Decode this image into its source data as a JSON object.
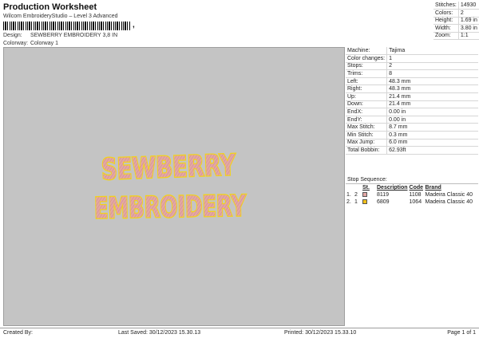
{
  "header": {
    "title": "Production Worksheet",
    "subtitle": "Wilcom EmbroideryStudio – Level 3 Advanced",
    "barcode_suffix": ","
  },
  "design": {
    "label": "Design:",
    "value": "SEWBERRY EMBROIDERY 3,8 IN"
  },
  "colorway": {
    "label": "Colorway:",
    "value": "Colorway 1"
  },
  "stats": [
    {
      "label": "Stitches:",
      "value": "14930"
    },
    {
      "label": "Colors:",
      "value": "2"
    },
    {
      "label": "Height:",
      "value": "1.69 in"
    },
    {
      "label": "Width:",
      "value": "3.80 in"
    },
    {
      "label": "Zoom:",
      "value": "1:1"
    }
  ],
  "canvas": {
    "line1": "SEWBERRY",
    "line2": "EMBROIDERY",
    "background": "#c4c4c4",
    "fill_color": "#e3a7a5",
    "outline_color": "#f2d21a"
  },
  "machine_info": [
    {
      "label": "Machine:",
      "value": "Tajima"
    },
    {
      "label": "Color changes:",
      "value": "1"
    },
    {
      "label": "Stops:",
      "value": "2"
    },
    {
      "label": "Trims:",
      "value": "8"
    },
    {
      "label": "Left:",
      "value": "48.3 mm"
    },
    {
      "label": "Right:",
      "value": "48.3 mm"
    },
    {
      "label": "Up:",
      "value": "21.4 mm"
    },
    {
      "label": "Down:",
      "value": "21.4 mm"
    },
    {
      "label": "EndX:",
      "value": "0.00 in"
    },
    {
      "label": "EndY:",
      "value": "0.00 in"
    },
    {
      "label": "Max Stitch:",
      "value": "8.7 mm"
    },
    {
      "label": "Min Stitch:",
      "value": "0.3 mm"
    },
    {
      "label": "Max Jump:",
      "value": "6.0 mm"
    },
    {
      "label": "Total Bobbin:",
      "value": "62.93ft"
    }
  ],
  "stop_sequence": {
    "title": "Stop Sequence:",
    "headers": {
      "st": "St.",
      "description": "Description",
      "code": "Code",
      "brand": "Brand"
    },
    "rows": [
      {
        "num": "1.",
        "st": "2",
        "swatch": "#e3a7a5",
        "description": "8119",
        "code": "1108",
        "brand": "Madeira Classic 40"
      },
      {
        "num": "2.",
        "st": "1",
        "swatch": "#f2c01a",
        "description": "6809",
        "code": "1064",
        "brand": "Madeira Classic 40"
      }
    ]
  },
  "footer": {
    "created_by": "Created By:",
    "last_saved": "Last Saved: 30/12/2023 15.30.13",
    "printed": "Printed: 30/12/2023 15.33.10",
    "page": "Page 1 of 1"
  }
}
